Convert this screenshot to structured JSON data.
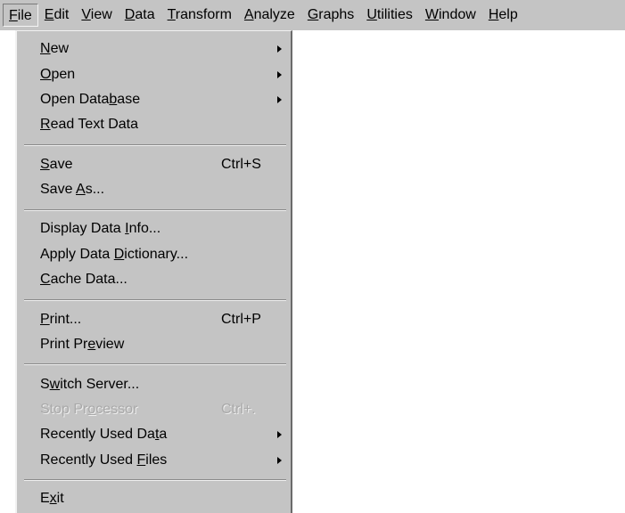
{
  "menubar": {
    "items": [
      {
        "label": "File"
      },
      {
        "label": "Edit"
      },
      {
        "label": "View"
      },
      {
        "label": "Data"
      },
      {
        "label": "Transform"
      },
      {
        "label": "Analyze"
      },
      {
        "label": "Graphs"
      },
      {
        "label": "Utilities"
      },
      {
        "label": "Window"
      },
      {
        "label": "Help"
      }
    ]
  },
  "file_menu": {
    "new": {
      "label": "New"
    },
    "open": {
      "label": "Open"
    },
    "open_database": {
      "label": "Open Database"
    },
    "read_text_data": {
      "label": "Read Text Data"
    },
    "save": {
      "label": "Save",
      "shortcut": "Ctrl+S"
    },
    "save_as": {
      "label": "Save As..."
    },
    "display_data_info": {
      "label": "Display Data Info..."
    },
    "apply_data_dictionary": {
      "label": "Apply Data Dictionary..."
    },
    "cache_data": {
      "label": "Cache Data..."
    },
    "print": {
      "label": "Print...",
      "shortcut": "Ctrl+P"
    },
    "print_preview": {
      "label": "Print Preview"
    },
    "switch_server": {
      "label": "Switch Server..."
    },
    "stop_processor": {
      "label": "Stop Processor",
      "shortcut": "Ctrl+."
    },
    "recently_used_data": {
      "label": "Recently Used Data"
    },
    "recently_used_files": {
      "label": "Recently Used Files"
    },
    "exit": {
      "label": "Exit"
    }
  }
}
